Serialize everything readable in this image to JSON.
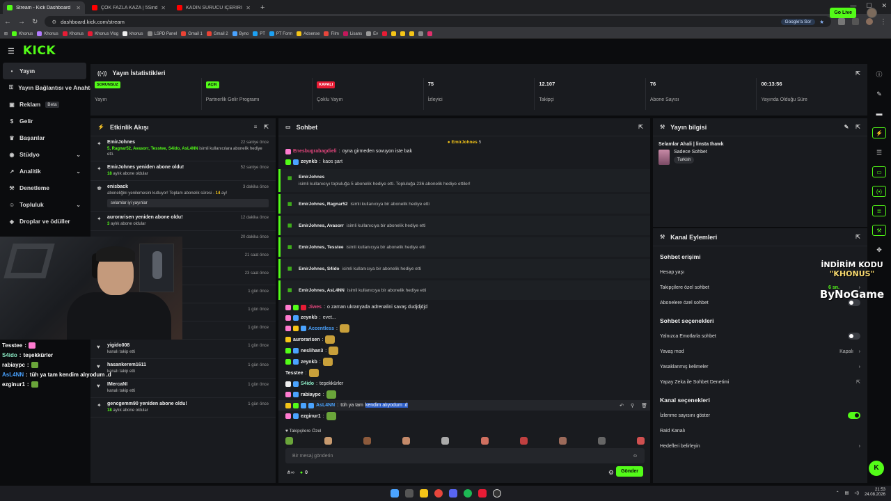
{
  "browser": {
    "tabs": [
      {
        "title": "Stream - Kick Dashboard",
        "color": "#53fc18",
        "active": true
      },
      {
        "title": "ÇOK FAZLA KAZA | 5Sinders | M...",
        "color": "#ff0000",
        "active": false
      },
      {
        "title": "KADIN SÜRÜCÜ İÇERİRI Türkiye...",
        "color": "#ff0000",
        "active": false
      }
    ],
    "url": "dashboard.kick.com/stream",
    "google_label": "Google'a Sor",
    "bookmarks": [
      "Khonus",
      "Khonus",
      "Khonus",
      "Khonus Vlog",
      "khonus",
      "LSPD Panel",
      "Gmail 1",
      "Gmail 2",
      "Byno",
      "PT",
      "PT Form",
      "Adsense",
      "Film",
      "Lisans",
      "Ev"
    ]
  },
  "kick": {
    "logo": "KICK",
    "go_live": "Go Live"
  },
  "sidebar": {
    "items": [
      {
        "label": "Yayın",
        "icon": "broadcast-icon",
        "glyph": "((•))",
        "active": true,
        "chevron": false
      },
      {
        "label": "Yayın Bağlantısı ve Anahtarı",
        "icon": "key-icon",
        "glyph": "⚿",
        "active": false,
        "chevron": false
      },
      {
        "label": "Reklam",
        "icon": "ad-icon",
        "glyph": "▣",
        "active": false,
        "chevron": false,
        "beta": "Beta"
      },
      {
        "label": "Gelir",
        "icon": "revenue-icon",
        "glyph": "$",
        "active": false,
        "chevron": false
      },
      {
        "label": "Başarılar",
        "icon": "trophy-icon",
        "glyph": "♛",
        "active": false,
        "chevron": false
      },
      {
        "label": "Stüdyo",
        "icon": "studio-icon",
        "glyph": "◉",
        "active": false,
        "chevron": true
      },
      {
        "label": "Analitik",
        "icon": "analytics-icon",
        "glyph": "↗",
        "active": false,
        "chevron": true
      },
      {
        "label": "Denetleme",
        "icon": "moderation-icon",
        "glyph": "⚒",
        "active": false,
        "chevron": false
      },
      {
        "label": "Topluluk",
        "icon": "community-icon",
        "glyph": "☺",
        "active": false,
        "chevron": true
      },
      {
        "label": "Droplar ve ödüller",
        "icon": "drops-icon",
        "glyph": "◈",
        "active": false,
        "chevron": false
      }
    ]
  },
  "stats": {
    "title": "Yayın İstatistikleri",
    "items": [
      {
        "badge": "SORUNSUZ",
        "badge_color": "#53fc18",
        "label": "Yayın"
      },
      {
        "badge": "AÇIK",
        "badge_color": "#53fc18",
        "label": "Partnerlik Gelir Programı"
      },
      {
        "badge": "KAPALI",
        "badge_color": "#e81c35",
        "label": "Çoklu Yayın"
      },
      {
        "value": "75",
        "label": "İzleyici"
      },
      {
        "value": "12.107",
        "label": "Takipçi"
      },
      {
        "value": "76",
        "label": "Abone Sayısı"
      },
      {
        "value": "00:13:56",
        "label": "Yayında Olduğu Süre"
      }
    ]
  },
  "activity": {
    "title": "Etkinlik Akışı",
    "items": [
      {
        "icon": "gift-icon",
        "glyph": "✦",
        "name": "EmirJohnes",
        "time": "22 saniye önce",
        "gifted": "5, Ragnar52, Avasorr, Tesstee, S4ido, AsL4NN",
        "sub": " isimli kullanıcılara abonelik hediye etti."
      },
      {
        "icon": "star-icon",
        "glyph": "✦",
        "name": "EmirJohnes yeniden abone oldu!",
        "time": "52 saniye önce",
        "months": "18",
        "sub": " aylık abone oldular"
      },
      {
        "icon": "crown-icon",
        "glyph": "♚",
        "name": "enisback",
        "time": "3 dakika önce",
        "sub": "aboneliğini yenilemesini kutluyor! Toplam abonelik süresi - ",
        "total": "14",
        "sub2": " ay!",
        "quote": "selamlar iyi yayınlar"
      },
      {
        "icon": "star-icon",
        "glyph": "✦",
        "name": "aurorarisen yeniden abone oldu!",
        "time": "12 dakika önce",
        "months": "3",
        "sub": " aylık abone oldular"
      },
      {
        "icon": "heart-icon",
        "glyph": "♥",
        "name": "yigido008",
        "time": "1 gün önce",
        "sub": "kanalı takip etti"
      },
      {
        "icon": "heart-icon",
        "glyph": "♥",
        "name": "hasankerem1611",
        "time": "1 gün önce",
        "sub": "kanalı takip etti"
      },
      {
        "icon": "heart-icon",
        "glyph": "♥",
        "name": "IMercaNI",
        "time": "1 gün önce",
        "sub": "kanalı takip etti"
      },
      {
        "icon": "star-icon",
        "glyph": "✦",
        "name": "gencgemm90 yeniden abone oldu!",
        "time": "1 gün önce",
        "months": "18",
        "sub": " aylık abone oldular"
      }
    ],
    "hidden_times": [
      "20 dakika önce",
      "21 saat önce",
      "23 saat önce",
      "1 gün önce",
      "1 gün önce",
      "1 gün önce"
    ]
  },
  "chat": {
    "title": "Sohbet",
    "pinned_user": "EmirJohnes",
    "pinned_count": "5",
    "messages": [
      {
        "type": "msg",
        "user": "Enesbugrabagdieli",
        "color": "#e0457b",
        "text": "oyna girmeden sovuyon iste bak",
        "badges": [
          "#ff7bd0"
        ]
      },
      {
        "type": "msg",
        "user": "zeynkb",
        "color": "#eeeeee",
        "text": "kaos şart",
        "badges": [
          "#53fc18",
          "#4aa3ff"
        ]
      },
      {
        "type": "card",
        "who": "EmirJohnes",
        "line2": "isimli kullanıcıyı topluluğa 5 abonelik hediye etti. Topluluğa 236 abonelik hediye ettiler!"
      },
      {
        "type": "small",
        "who": "EmirJohnes, Ragnar52",
        "txt": "isimli kullanıcıya bir abonelik hediye etti"
      },
      {
        "type": "small",
        "who": "EmirJohnes, Avasorr",
        "txt": "isimli kullanıcıya bir abonelik hediye etti"
      },
      {
        "type": "small",
        "who": "EmirJohnes, Tesstee",
        "txt": "isimli kullanıcıya bir abonelik hediye etti"
      },
      {
        "type": "small",
        "who": "EmirJohnes, S4ido",
        "txt": "isimli kullanıcıya bir abonelik hediye etti"
      },
      {
        "type": "small",
        "who": "EmirJohnes, AsL4NN",
        "txt": "isimli kullanıcıya bir abonelik hediye etti"
      },
      {
        "type": "msg",
        "user": "Jiwes",
        "color": "#e0457b",
        "text": "o zaman ukranyada adrenalini savaş dudjdjdjd",
        "badges": [
          "#ff7bd0",
          "#53fc18",
          "#e81c35"
        ]
      },
      {
        "type": "msg",
        "user": "zeynkb",
        "color": "#eeeeee",
        "text": "evet...",
        "badges": [
          "#ff7bd0",
          "#4aa3ff"
        ]
      },
      {
        "type": "msg",
        "user": "Accentless",
        "color": "#4aa3ff",
        "text": "",
        "emote": "emote",
        "badges": [
          "#ff7bd0",
          "#f5c518",
          "#4aa3ff"
        ]
      },
      {
        "type": "msg",
        "user": "aurorarisen",
        "color": "#eeeeee",
        "text": "",
        "emote": "emote",
        "badges": [
          "#f5c518"
        ]
      },
      {
        "type": "msg",
        "user": "neslihan3",
        "color": "#eeeeee",
        "text": "",
        "emote": "emote",
        "badges": [
          "#53fc18",
          "#4aa3ff"
        ]
      },
      {
        "type": "msg",
        "user": "zeynkb",
        "color": "#eeeeee",
        "text": "",
        "emote": "emote",
        "badges": [
          "#53fc18",
          "#4aa3ff"
        ]
      },
      {
        "type": "msg",
        "user": "Tesstee",
        "color": "#eeeeee",
        "text": "",
        "emote": "emote",
        "badges": []
      },
      {
        "type": "msg",
        "user": "S4ido",
        "color": "#8be9c4",
        "text": "teşekkürler",
        "badges": [
          "#eeeeee",
          "#4aa3ff"
        ]
      },
      {
        "type": "msg",
        "user": "rabiaypc",
        "color": "#eeeeee",
        "text": "",
        "emote": "emote frog",
        "badges": [
          "#ff7bd0",
          "#4aa3ff"
        ]
      },
      {
        "type": "msg",
        "user": "AsL4NN",
        "color": "#4aa3ff",
        "text": "tüh ya tam ",
        "selected": "kendim alıyodum .d",
        "badges": [
          "#f5c518",
          "#53fc18",
          "#4aa3ff",
          "#4aa3ff"
        ],
        "hover": true
      },
      {
        "type": "msg",
        "user": "ezginur1",
        "color": "#eeeeee",
        "text": "",
        "emote": "emote frog",
        "badges": [
          "#ff7bd0",
          "#4aa3ff"
        ]
      }
    ],
    "followers_only": "Takipçilere Özel",
    "placeholder": "Bir mesaj gönderin",
    "viewer_count": "0",
    "send": "Gönder"
  },
  "stream_info": {
    "title": "Yayın bilgisi",
    "stream_title": "Selamlar Ahali | linsta Ihawk",
    "category": "Sadece Sohbet",
    "tag": "Turkish"
  },
  "channel_actions": {
    "title": "Kanal Eylemleri",
    "chat_access": "Sohbet erişimi",
    "account_age": "Hesap yaşı",
    "followers_only": "Takipçilere özel sohbet",
    "followers_time": "6 sn.",
    "subscribers_only": "Abonelere özel sohbet",
    "chat_options": "Sohbet seçenekleri",
    "emotes_only": "Yalnızca Emotlarla sohbet",
    "slow_mode": "Yavaş mod",
    "slow_mode_value": "Kapalı",
    "banned_words": "Yasaklanmış kelimeler",
    "ai_moderation": "Yapay Zeka ile Sohbet Denetimi",
    "channel_options": "Kanal seçenekleri",
    "show_viewers": "İzlenme sayısını göster",
    "raid": "Raid Kanalı",
    "goals": "Hedefleri belirleyin"
  },
  "overlay_chat": [
    {
      "user": "Tesstee",
      "color": "#ffffff",
      "text": ""
    },
    {
      "user": "S4ido",
      "color": "#8be9c4",
      "text": "teşekkürler"
    },
    {
      "user": "rabiaypc",
      "color": "#ffffff",
      "text": ""
    },
    {
      "user": "AsL4NN",
      "color": "#4aa3ff",
      "text": "tüh ya tam kendim alıyodum .d"
    },
    {
      "user": "ezginur1",
      "color": "#ffffff",
      "text": ""
    }
  ],
  "promo": {
    "line1": "İNDİRİM KODU",
    "line2": "\"KHONUS\"",
    "brand": "ByNoGame"
  },
  "taskbar": {
    "time": "21:53",
    "date": "24.08.2026"
  }
}
